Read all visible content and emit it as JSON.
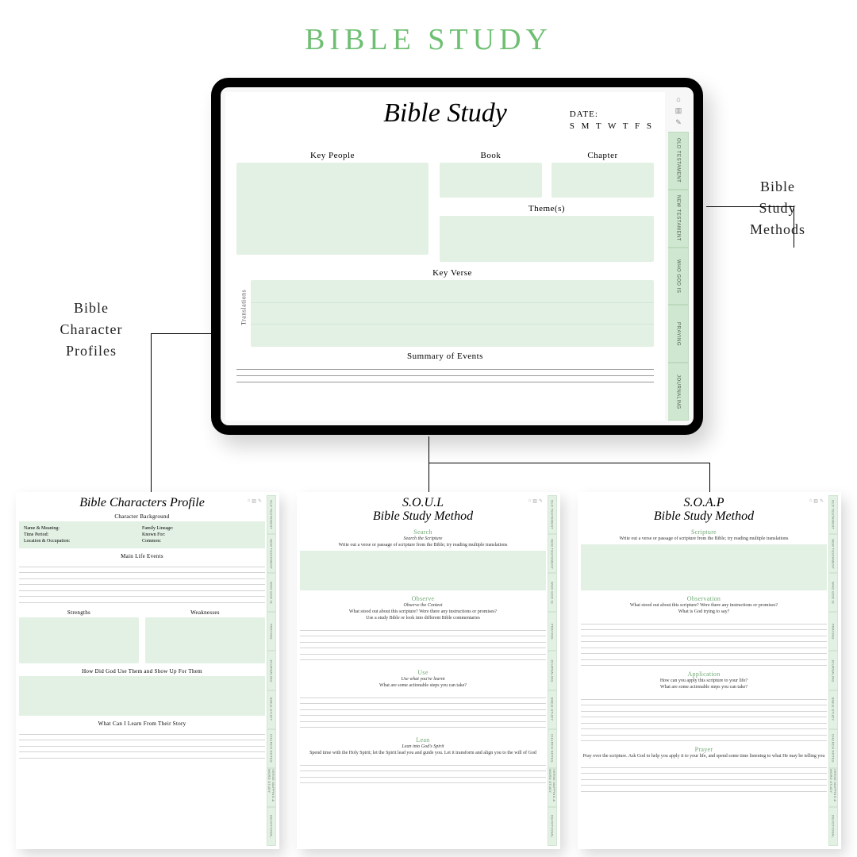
{
  "mainTitle": "BIBLE STUDY",
  "callouts": {
    "left": "Bible\nCharacter\nProfiles",
    "right": "Bible\nStudy\nMethods"
  },
  "tablet": {
    "title": "Bible Study",
    "dateLabel": "DATE:",
    "days": "S  M  T  W  T  F  S",
    "fields": {
      "keyPeople": "Key People",
      "book": "Book",
      "chapter": "Chapter",
      "themes": "Theme(s)",
      "keyVerse": "Key Verse",
      "translations": "Translations",
      "summary": "Summary of Events"
    },
    "tabs": [
      "OLD TESTAMENT",
      "NEW TESTAMENT",
      "WHO GOD IS",
      "PRAYING",
      "JOURNALING"
    ]
  },
  "sheet1": {
    "title": "Bible Characters Profile",
    "sections": {
      "bg": "Character Background",
      "bgFields": {
        "name": "Name & Meaning:",
        "family": "Family Lineage:",
        "time": "Time Period:",
        "known": "Known For:",
        "location": "Location & Occupation:",
        "common": "Common:"
      },
      "mainLife": "Main Life Events",
      "strengths": "Strengths",
      "weaknesses": "Weaknesses",
      "howGod": "How Did God Use Them and Show Up For Them",
      "learn": "What Can I Learn From Their Story"
    }
  },
  "sheet2": {
    "title1": "S.O.U.L",
    "title2": "Bible Study Method",
    "search": {
      "head": "Search",
      "sub": "Search the Scripture",
      "desc": "Write out a verse or passage of scripture from the Bible; try reading multiple translations"
    },
    "observe": {
      "head": "Observe",
      "sub": "Observe the Context",
      "desc": "What stood out about this scripture? Were there any instructions or promises?\nUse a study Bible or look into different Bible commentaries"
    },
    "use": {
      "head": "Use",
      "sub": "Use what you've learnt",
      "desc": "What are some actionable steps you can take?"
    },
    "lean": {
      "head": "Lean",
      "sub": "Lean into God's Spirit",
      "desc": "Spend time with the Holy Spirit; let the Spirit lead you and guide you. Let it transform and align you to the will of God"
    }
  },
  "sheet3": {
    "title1": "S.O.A.P",
    "title2": "Bible Study Method",
    "scripture": {
      "head": "Scripture",
      "desc": "Write out a verse or passage of scripture from the Bible; try reading multiple translations"
    },
    "observation": {
      "head": "Observation",
      "desc": "What stood out about this scripture? Were there any instructions or promises?\nWhat is God trying to say?"
    },
    "application": {
      "head": "Application",
      "desc": "How can you apply this scripture to your life?\nWhat are some actionable steps you can take?"
    },
    "prayer": {
      "head": "Prayer",
      "desc": "Pray over the scripture. Ask God to help you apply it to your life, and spend some time listening to what He may be telling you"
    }
  },
  "sheetTabs": [
    "OLD TESTAMENT",
    "NEW TESTAMENT",
    "WHO GOD IS",
    "PRAYING",
    "JOURNALING",
    "BIBLE STUDY",
    "CHURCH NOTES",
    "VERSE MAPPING & WORD STUDY",
    "DEVOTIONAL"
  ]
}
